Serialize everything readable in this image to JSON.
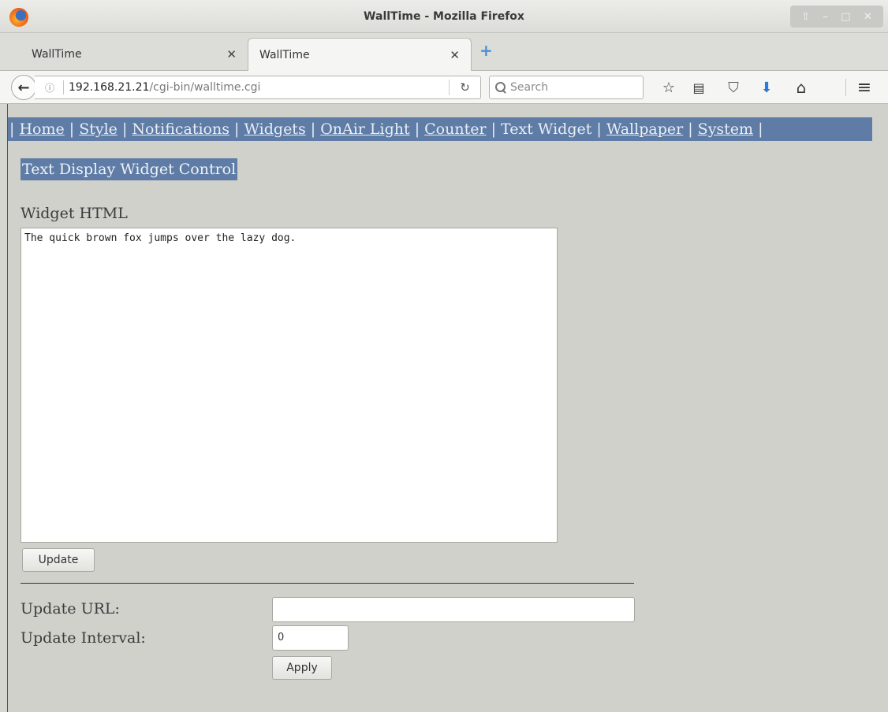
{
  "window": {
    "title": "WallTime - Mozilla Firefox",
    "controls": [
      "⇧",
      "–",
      "□",
      "✕"
    ]
  },
  "tabs": [
    {
      "label": "WallTime",
      "close": "✕",
      "active": false
    },
    {
      "label": "WallTime",
      "close": "✕",
      "active": true
    }
  ],
  "new_tab_label": "+",
  "navbar": {
    "url_host": "192.168.21.21",
    "url_path": "/cgi-bin/walltime.cgi",
    "info_icon": "ⓘ",
    "reload_icon": "↻",
    "search_placeholder": "Search",
    "toolbar_icons": {
      "bookmark": "☆",
      "reading_list": "▤",
      "pocket": "⛉",
      "downloads": "⬇",
      "home": "⌂",
      "menu": "≡"
    }
  },
  "page": {
    "menu": {
      "sep": "|",
      "items": [
        {
          "label": "Home",
          "link": true
        },
        {
          "label": "Style",
          "link": true
        },
        {
          "label": "Notifications",
          "link": true
        },
        {
          "label": "Widgets",
          "link": true
        },
        {
          "label": "OnAir Light",
          "link": true
        },
        {
          "label": "Counter",
          "link": true
        },
        {
          "label": "Text Widget",
          "link": false
        },
        {
          "label": "Wallpaper",
          "link": true
        },
        {
          "label": "System",
          "link": true
        }
      ]
    },
    "section_title": "Text Display Widget Control",
    "widget_html_label": "Widget HTML",
    "widget_html_value": "The quick brown fox jumps over the lazy dog.",
    "update_button": "Update",
    "update_url_label": "Update URL:",
    "update_url_value": "",
    "update_interval_label": "Update Interval:",
    "update_interval_value": "0",
    "apply_button": "Apply"
  },
  "colors": {
    "menu_bg": "#5e7ca5",
    "page_bg": "#d1d1cc",
    "downloads_icon": "#2d7bd9"
  }
}
